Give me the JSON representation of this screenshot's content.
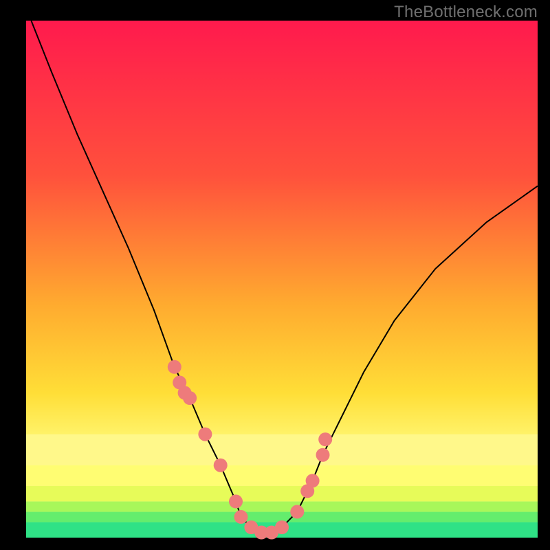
{
  "watermark": "TheBottleneck.com",
  "chart_data": {
    "type": "line",
    "title": "",
    "xlabel": "",
    "ylabel": "",
    "xlim": [
      0,
      100
    ],
    "ylim": [
      0,
      100
    ],
    "series": [
      {
        "name": "bottleneck-curve",
        "x": [
          1,
          5,
          10,
          15,
          20,
          25,
          29,
          32,
          35,
          38,
          41,
          42,
          44,
          46,
          48,
          50,
          53,
          56,
          58,
          62,
          66,
          72,
          80,
          90,
          100
        ],
        "y": [
          100,
          90,
          78,
          67,
          56,
          44,
          33,
          27,
          20,
          14,
          7,
          4,
          2,
          1,
          1,
          2,
          5,
          11,
          16,
          24,
          32,
          42,
          52,
          61,
          68
        ]
      }
    ],
    "markers": {
      "name": "highlight-dots",
      "x": [
        29,
        30,
        31,
        32,
        35,
        38,
        41,
        42,
        44,
        46,
        48,
        50,
        53,
        55,
        56,
        58,
        58.5
      ],
      "y": [
        33,
        30,
        28,
        27,
        20,
        14,
        7,
        4,
        2,
        1,
        1,
        2,
        5,
        9,
        11,
        16,
        19
      ]
    },
    "bands": [
      {
        "y0": 0,
        "y1": 3,
        "color": "#2fe286"
      },
      {
        "y0": 3,
        "y1": 5,
        "color": "#64ed6d"
      },
      {
        "y0": 5,
        "y1": 7,
        "color": "#a8f75a"
      },
      {
        "y0": 7,
        "y1": 10,
        "color": "#e7fb59"
      },
      {
        "y0": 10,
        "y1": 14,
        "color": "#fffd72"
      },
      {
        "y0": 14,
        "y1": 20,
        "color": "#fff88a"
      }
    ],
    "gradient_stops": [
      {
        "offset": 0,
        "color": "#ff1a4d"
      },
      {
        "offset": 30,
        "color": "#ff513c"
      },
      {
        "offset": 55,
        "color": "#ffab2f"
      },
      {
        "offset": 72,
        "color": "#ffde37"
      },
      {
        "offset": 82,
        "color": "#fff774"
      },
      {
        "offset": 100,
        "color": "#ffffb0"
      }
    ]
  }
}
